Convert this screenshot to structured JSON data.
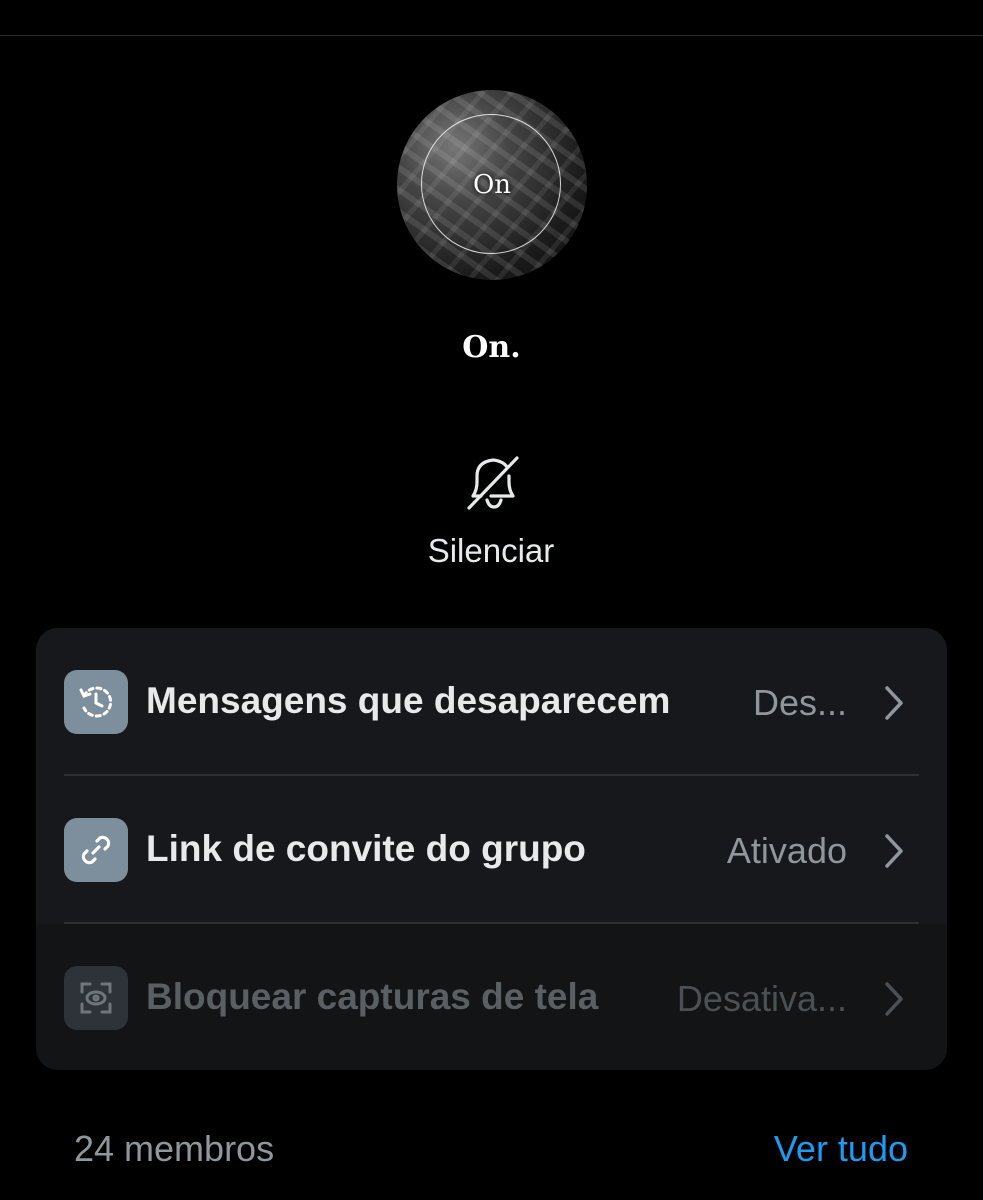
{
  "group": {
    "avatar_text": "On",
    "name": "On."
  },
  "mute": {
    "label": "Silenciar",
    "icon": "bell-slash-icon"
  },
  "settings": {
    "rows": [
      {
        "label": "Mensagens que desaparecem",
        "value": "Des...",
        "icon": "timer-history-icon"
      },
      {
        "label": "Link de convite do grupo",
        "value": "Ativado",
        "icon": "link-icon"
      },
      {
        "label": "Bloquear capturas de tela",
        "value": "Desativa...",
        "icon": "screenshot-block-icon"
      }
    ]
  },
  "members": {
    "count_label": "24 membros",
    "see_all_label": "Ver tudo"
  },
  "colors": {
    "background": "#000000",
    "card": "#16181c",
    "icon_tile": "#7d8f9c",
    "accent": "#1d9bf0",
    "muted_text": "#8f969c"
  }
}
